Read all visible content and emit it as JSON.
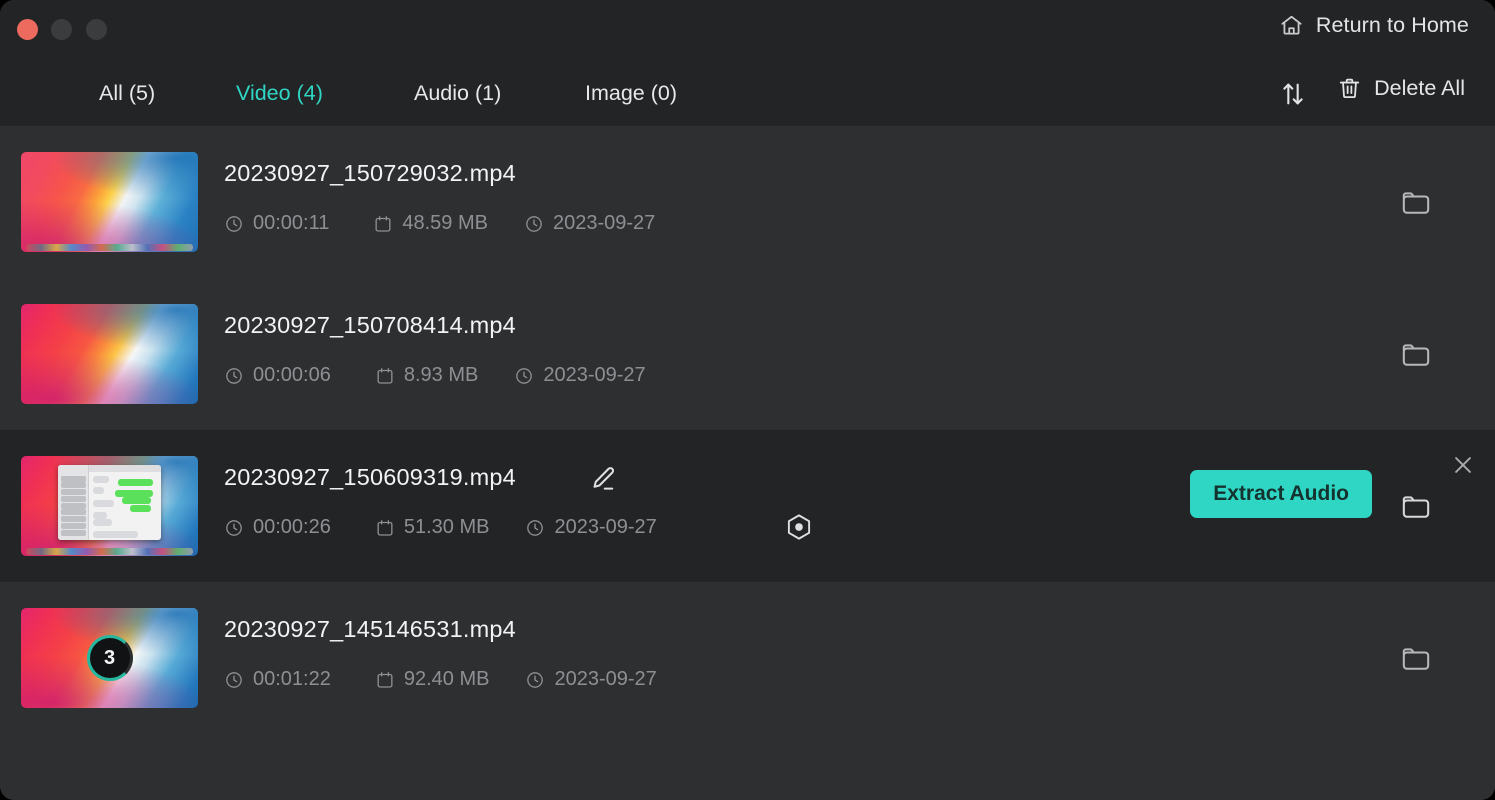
{
  "window": {
    "traffic_lights": [
      "close",
      "minimize",
      "zoom"
    ],
    "accent_color": "#2fd6c4",
    "header_bg": "#232426",
    "list_bg": "#2e2f31"
  },
  "titlebar": {
    "home_icon": "home-icon",
    "home_label": "Return to Home"
  },
  "toolbar": {
    "tabs": [
      {
        "label": "All (5)",
        "active": false
      },
      {
        "label": "Video (4)",
        "active": true
      },
      {
        "label": "Audio (1)",
        "active": false
      },
      {
        "label": "Image (0)",
        "active": false
      }
    ],
    "sort_icon": "sort-arrows-icon",
    "delete_icon": "trash-icon",
    "delete_label": "Delete All"
  },
  "files": [
    {
      "name": "20230927_150729032.mp4",
      "duration": "00:00:11",
      "size": "48.59 MB",
      "date": "2023-09-27",
      "thumbnail": "macos-desktop-wallpaper",
      "hovered": false
    },
    {
      "name": "20230927_150708414.mp4",
      "duration": "00:00:06",
      "size": "8.93 MB",
      "date": "2023-09-27",
      "thumbnail": "macos-wallpaper-plain",
      "hovered": false
    },
    {
      "name": "20230927_150609319.mp4",
      "duration": "00:00:26",
      "size": "51.30 MB",
      "date": "2023-09-27",
      "thumbnail": "macos-messages-window",
      "hovered": true,
      "extract_label": "Extract Audio"
    },
    {
      "name": "20230927_145146531.mp4",
      "duration": "00:01:22",
      "size": "92.40 MB",
      "date": "2023-09-27",
      "thumbnail": "countdown-overlay",
      "countdown": "3",
      "hovered": false
    }
  ],
  "icons": {
    "duration": "clock-icon",
    "size": "calendar-icon",
    "date": "clock-icon",
    "edit": "pencil-edit-icon",
    "config": "hex-settings-icon",
    "folder": "folder-icon",
    "close": "close-icon"
  }
}
